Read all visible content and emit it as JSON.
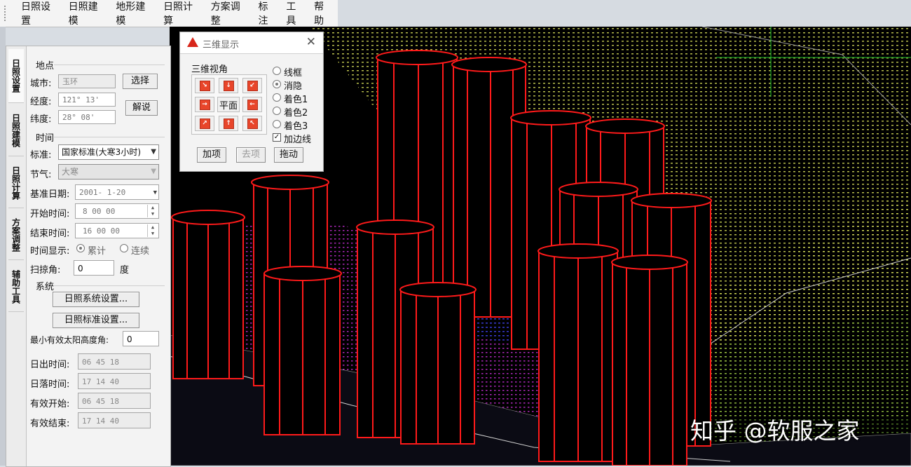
{
  "menubar": {
    "items": [
      "日照设置",
      "日照建模",
      "地形建模",
      "日照计算",
      "方案调整",
      "标注",
      "工具",
      "帮助"
    ]
  },
  "sidebar_tabs": [
    "日照设置",
    "日照建模",
    "日照计算",
    "方案调整",
    "辅助工具"
  ],
  "panel": {
    "location": {
      "section_label": "地点",
      "city_label": "城市:",
      "city_value": "玉环",
      "select_button": "选择",
      "longitude_label": "经度:",
      "longitude_value": "121° 13'",
      "latitude_label": "纬度:",
      "latitude_value": "28° 08'",
      "lookup_button": "解说"
    },
    "time": {
      "section_label": "时间",
      "standard_label": "标准:",
      "standard_value": "国家标准(大寒3小时)",
      "solar_term_label": "节气:",
      "solar_term_value": "大寒",
      "base_date_label": "基准日期:",
      "base_date_value": "2001- 1-20",
      "start_label": "开始时间:",
      "start_value": "8 00 00",
      "end_label": "结束时间:",
      "end_value": "16 00 00",
      "display_label": "时间显示:",
      "display_option_1": "累计",
      "display_option_2": "连续",
      "scan_label": "扫掠角:",
      "scan_value": "0",
      "scan_unit": "度"
    },
    "system": {
      "section_label": "系统",
      "sys_settings_button": "日照系统设置...",
      "std_settings_button": "日照标准设置...",
      "min_angle_label": "最小有效太阳高度角:",
      "min_angle_value": "0"
    },
    "results": {
      "sunrise_label": "日出时间:",
      "sunrise_value": "06 45 18",
      "sunset_label": "日落时间:",
      "sunset_value": "17 14 40",
      "eff_start_label": "有效开始:",
      "eff_start_value": "06 45 18",
      "eff_end_label": "有效结束:",
      "eff_end_value": "17 14 40"
    }
  },
  "dialog": {
    "title": "三维显示",
    "group_label": "三维视角",
    "center_button": "平面",
    "styles": [
      "线框",
      "消隐",
      "着色1",
      "着色2",
      "着色3"
    ],
    "selected_style": "消隐",
    "edge_checkbox": "加边线",
    "add_button": "加项",
    "remove_button": "去项",
    "drag_button": "拖动"
  },
  "watermark": "知乎 @软服之家",
  "colors": {
    "building_outline": "#ff1a1a",
    "viewport_bg": "#000000",
    "terrain_points": "#d9e05a",
    "accent_red": "#e8452a"
  }
}
